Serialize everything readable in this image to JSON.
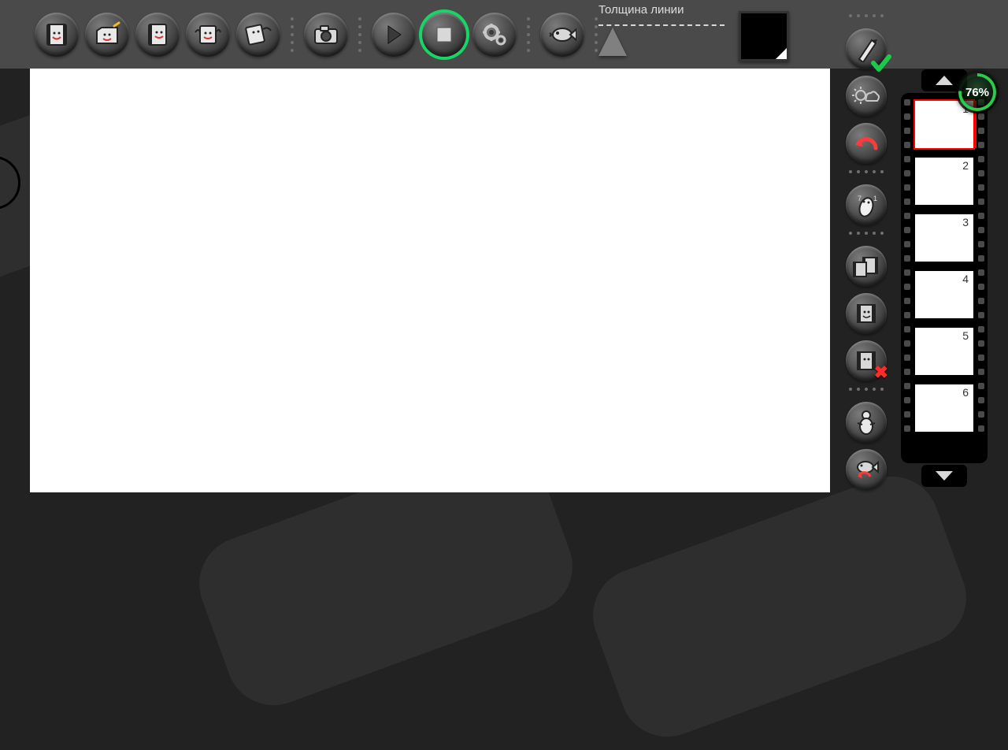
{
  "lineWidth": {
    "label": "Толщина линии"
  },
  "color": {
    "current": "#000000"
  },
  "battery": {
    "text": "76%",
    "value": 76
  },
  "toolbar": {
    "items": [
      {
        "name": "new-movie-button",
        "icon": "film-smile"
      },
      {
        "name": "open-movie-button",
        "icon": "folder-smile"
      },
      {
        "name": "save-movie-button",
        "icon": "film-save"
      },
      {
        "name": "export-button",
        "icon": "film-share"
      },
      {
        "name": "share-button",
        "icon": "film-send"
      },
      {
        "name": "camera-button",
        "icon": "camera"
      },
      {
        "name": "play-button",
        "icon": "play"
      },
      {
        "name": "stop-button",
        "icon": "stop",
        "highlighted": true
      },
      {
        "name": "settings-button",
        "icon": "gear"
      },
      {
        "name": "flip-button",
        "icon": "fish"
      }
    ]
  },
  "rightTools": {
    "items": [
      {
        "name": "pen-tool-button",
        "icon": "pen",
        "check": true
      },
      {
        "name": "onion-skin-button",
        "icon": "sun-cloud"
      },
      {
        "name": "undo-button",
        "icon": "undo"
      },
      {
        "name": "finger-tool-button",
        "icon": "finger"
      },
      {
        "name": "copy-frame-button",
        "icon": "film-dup"
      },
      {
        "name": "add-frame-button",
        "icon": "film-add"
      },
      {
        "name": "delete-frame-button",
        "icon": "film-del",
        "x": true
      },
      {
        "name": "puppet-button",
        "icon": "person"
      },
      {
        "name": "revert-button",
        "icon": "fish-undo"
      }
    ]
  },
  "frames": {
    "count": 6,
    "selected": 1,
    "items": [
      {
        "n": "1"
      },
      {
        "n": "2"
      },
      {
        "n": "3"
      },
      {
        "n": "4"
      },
      {
        "n": "5"
      },
      {
        "n": "6"
      }
    ]
  }
}
